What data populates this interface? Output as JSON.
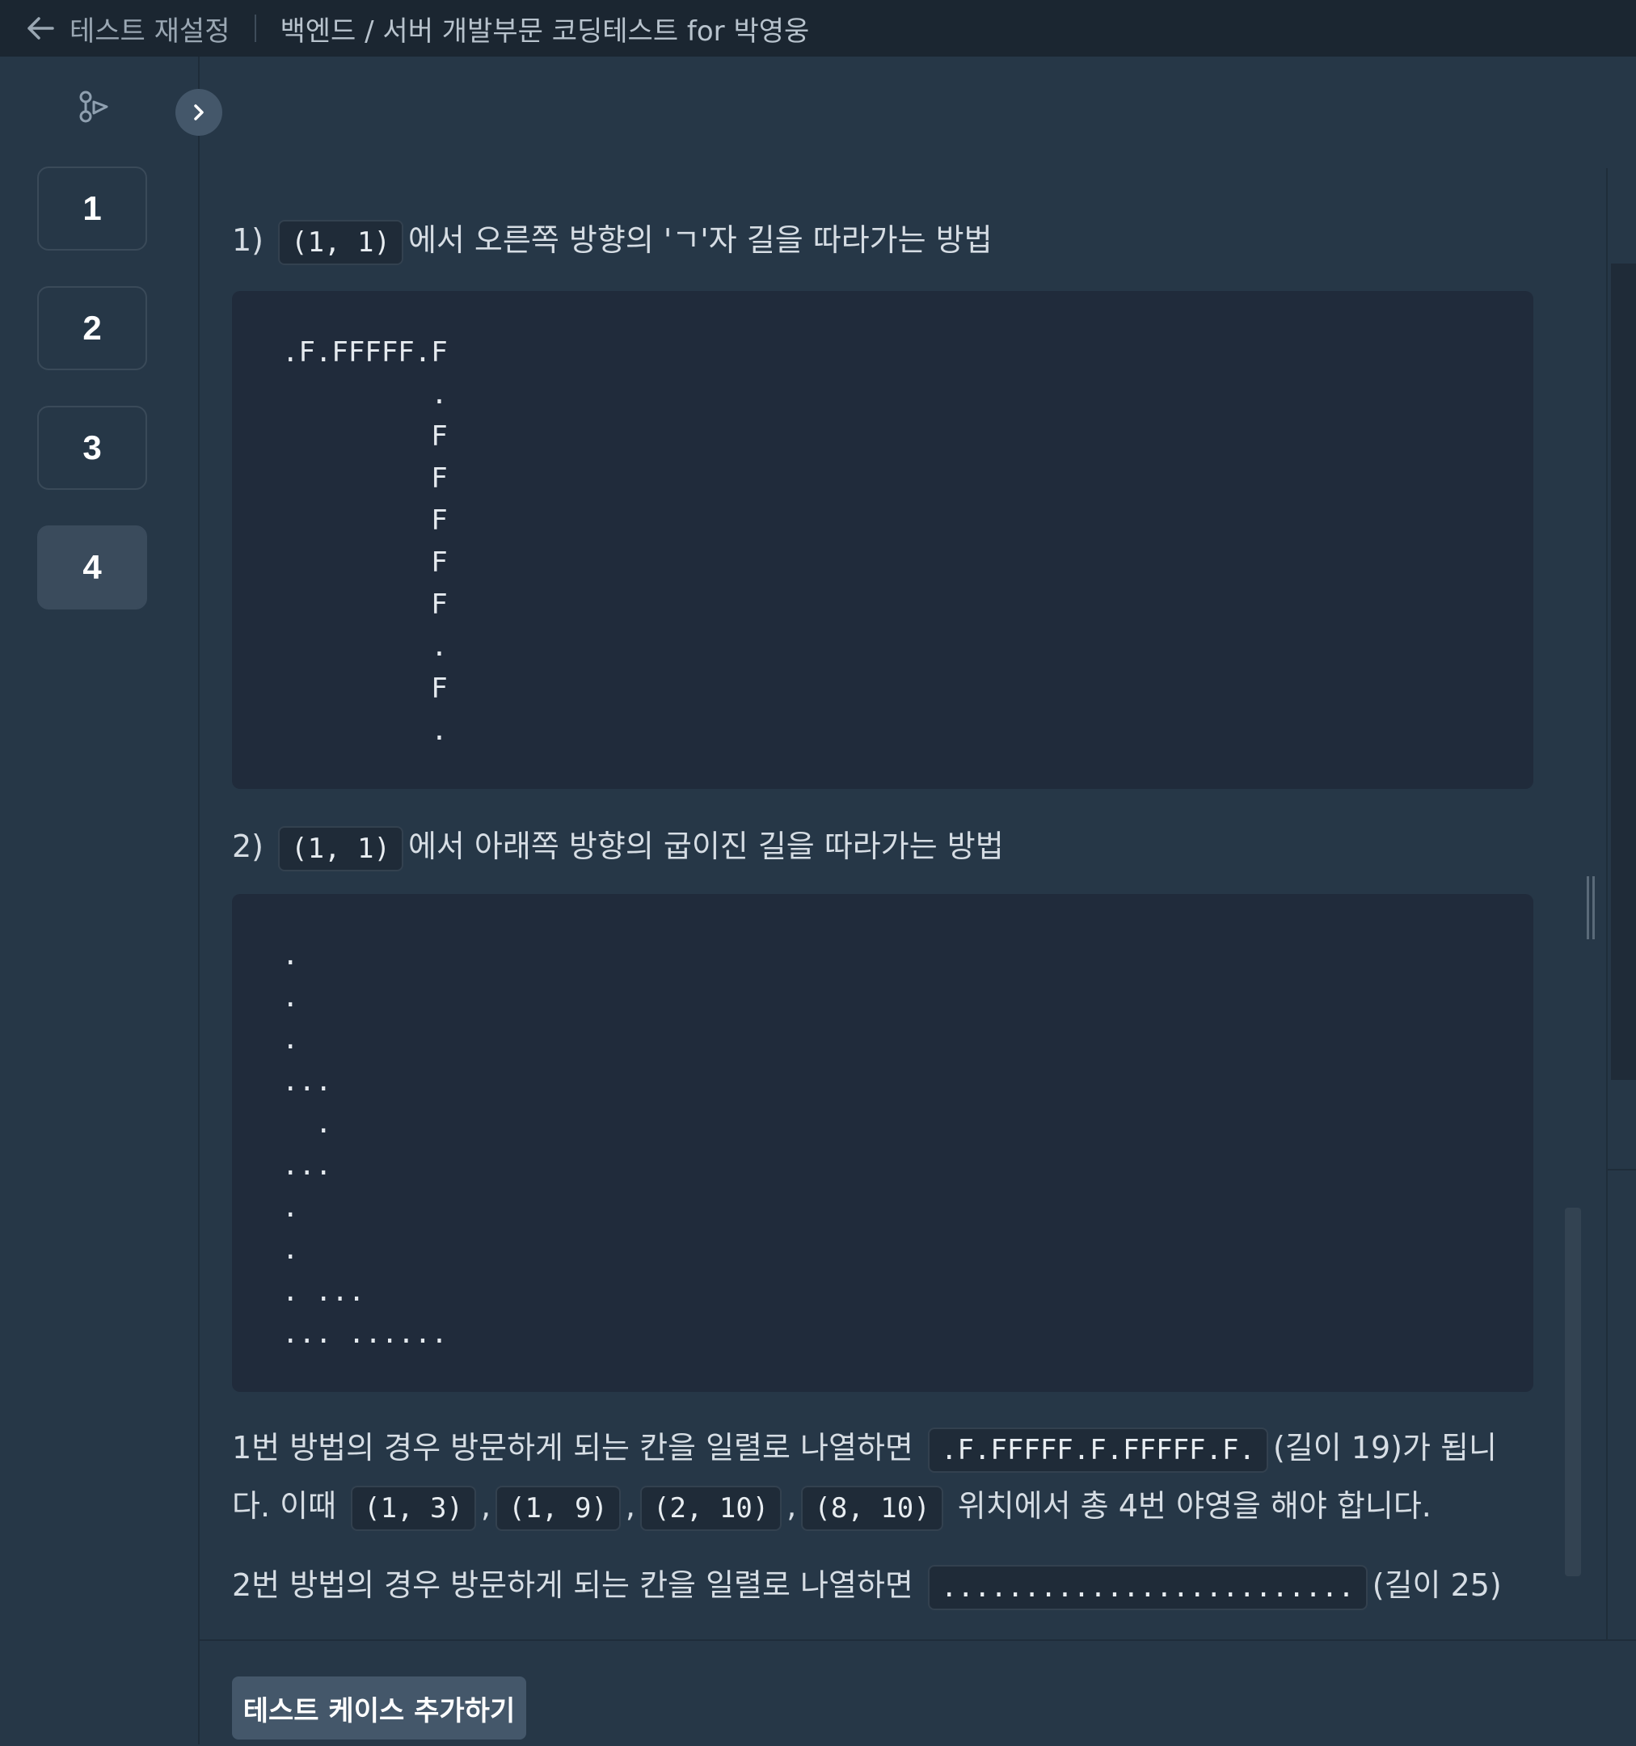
{
  "topbar": {
    "reset_label": "테스트 재설정",
    "title": "백엔드 / 서버 개발부문 코딩테스트 for 박영웅"
  },
  "sidebar": {
    "questions": [
      {
        "label": "1",
        "active": false
      },
      {
        "label": "2",
        "active": false
      },
      {
        "label": "3",
        "active": false
      },
      {
        "label": "4",
        "active": true
      }
    ]
  },
  "problem": {
    "method1_prefix": "1)",
    "method1_coord": "(1, 1)",
    "method1_text": "에서 오른쪽 방향의 'ㄱ'자 길을 따라가는 방법",
    "code1": ".F.FFFFF.F\n         .\n         F\n         F\n         F\n         F\n         F\n         .\n         F\n         .",
    "method2_prefix": "2)",
    "method2_coord": "(1, 1)",
    "method2_text": "에서 아래쪽 방향의 굽이진 길을 따라가는 방법",
    "code2": ".\n.\n.\n...\n  .\n...\n.\n.\n. ...\n... ......",
    "summary1_a": "1번 방법의 경우 방문하게 되는 칸을 일렬로 나열하면",
    "summary1_code": ".F.FFFFF.F.FFFFF.F.",
    "summary1_b": "(길이 19)가 됩니",
    "summary1_c": "다. 이때",
    "summary1_pos": [
      "(1, 3)",
      "(1, 9)",
      "(2, 10)",
      "(8, 10)"
    ],
    "summary1_d": "위치에서 총 4번 야영을 해야 합니다.",
    "summary2_a": "2번 방법의 경우 방문하게 되는 칸을 일렬로 나열하면",
    "summary2_code": ".........................",
    "summary2_b": "(길이 25)"
  },
  "bottom": {
    "add_testcase_label": "테스트 케이스 추가하기"
  }
}
